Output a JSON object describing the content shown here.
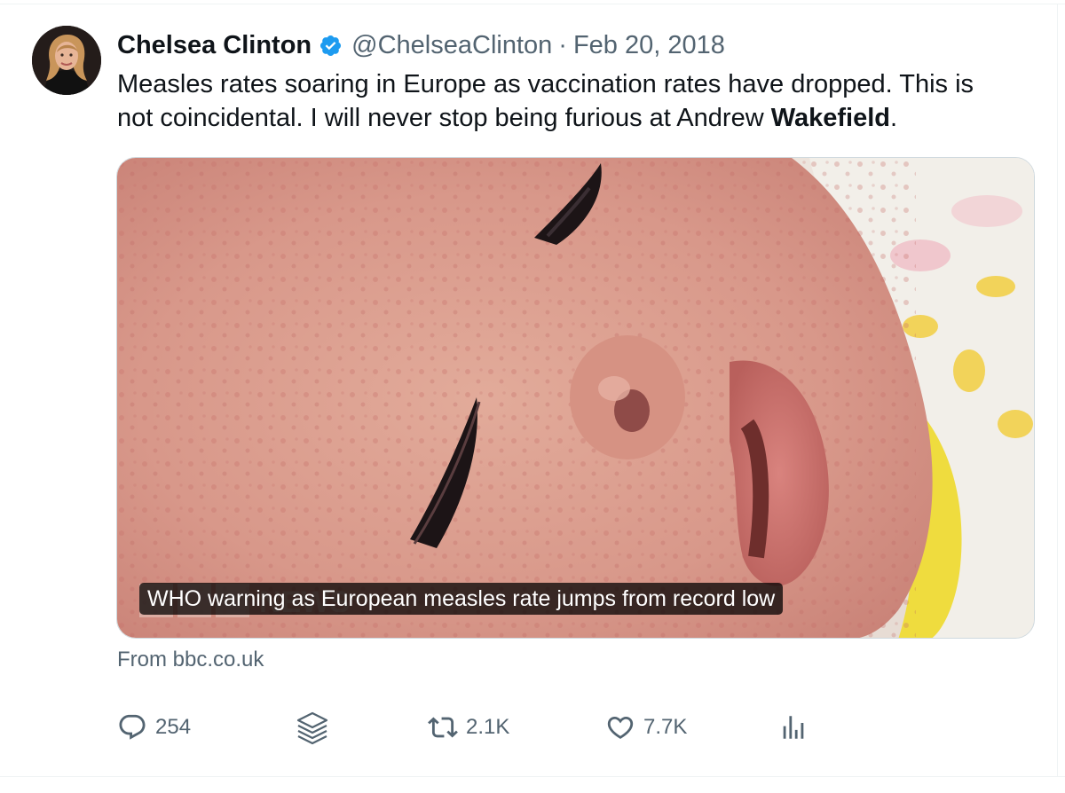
{
  "tweet": {
    "author_name": "Chelsea Clinton",
    "verified_icon": "verified-badge-icon",
    "handle": "@ChelseaClinton",
    "separator": "·",
    "date": "Feb 20, 2018",
    "text_line1": "Measles rates soaring in Europe as vaccination rates have dropped. This is",
    "text_line2_start": "not coincidental. I will never stop being furious at Andrew ",
    "text_line2_bold": "Wakefield",
    "text_line2_end": "."
  },
  "card": {
    "title": "WHO warning as European measles rate jumps from record low",
    "source": "From bbc.co.uk"
  },
  "actions": {
    "replies": "254",
    "retweets": "2.1K",
    "likes": "7.7K"
  },
  "colors": {
    "text_primary": "#0f1419",
    "text_secondary": "#536471",
    "verified_blue": "#1d9bf0",
    "border": "#cfd9de"
  }
}
